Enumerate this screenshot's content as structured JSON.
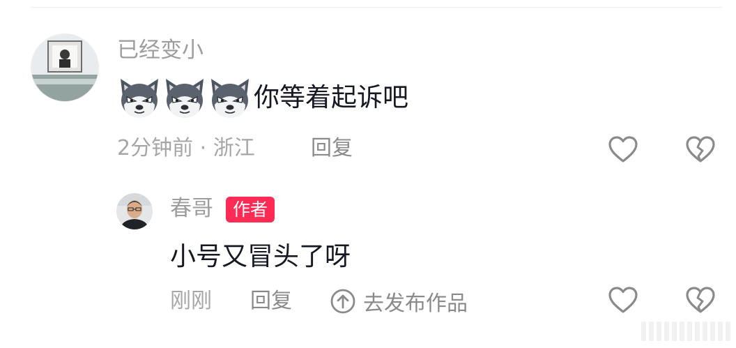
{
  "comments": [
    {
      "username": "已经变小",
      "emoji_icons": [
        "husky-dog-emoji-icon",
        "husky-dog-emoji-icon",
        "husky-dog-emoji-icon"
      ],
      "text": "你等着起诉吧",
      "time_location": "2分钟前 · 浙江",
      "reply_label": "回复",
      "like_icon": "heart-outline-icon",
      "dislike_icon": "broken-heart-icon"
    },
    {
      "username": "春哥",
      "badge": "作者",
      "text": "小号又冒头了呀",
      "time": "刚刚",
      "reply_label": "回复",
      "post_link_label": "去发布作品",
      "post_link_icon": "up-arrow-circle-icon",
      "like_icon": "heart-outline-icon",
      "dislike_icon": "broken-heart-icon"
    }
  ],
  "colors": {
    "primary_text": "#161823",
    "secondary_text": "#9d9d9d",
    "badge_bg": "#fe2c55",
    "badge_text": "#ffffff"
  }
}
